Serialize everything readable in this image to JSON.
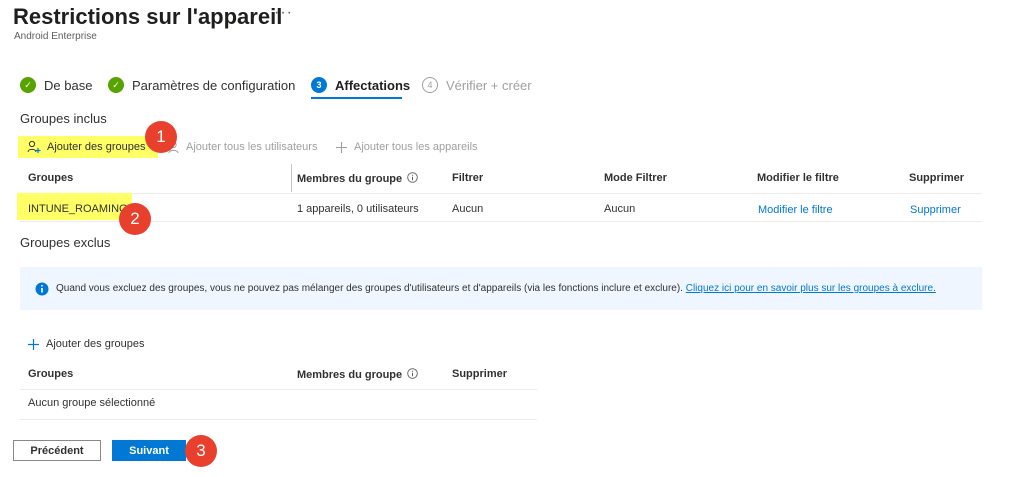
{
  "header": {
    "title": "Restrictions sur l'appareil",
    "more": "···",
    "subtitle": "Android Enterprise"
  },
  "steps": [
    {
      "label": "De base",
      "state": "done",
      "marker": "✓"
    },
    {
      "label": "Paramètres de configuration",
      "state": "done",
      "marker": "✓"
    },
    {
      "label": "Affectations",
      "state": "current",
      "marker": "3"
    },
    {
      "label": "Vérifier + créer",
      "state": "disabled",
      "marker": "4"
    }
  ],
  "included": {
    "title": "Groupes inclus",
    "add_groups": "Ajouter des groupes",
    "add_all_users": "Ajouter tous les utilisateurs",
    "add_all_devices": "Ajouter tous les appareils",
    "columns": [
      "Groupes",
      "Membres du groupe",
      "Filtrer",
      "Mode Filtrer",
      "Modifier le filtre",
      "Supprimer"
    ],
    "info_icon": "info-icon",
    "row": {
      "group": "INTUNE_ROAMING",
      "members": "1 appareils, 0 utilisateurs",
      "filter": "Aucun",
      "filter_mode": "Aucun",
      "edit_filter": "Modifier le filtre",
      "delete": "Supprimer"
    }
  },
  "excluded": {
    "title": "Groupes exclus",
    "info_text": "Quand vous excluez des groupes, vous ne pouvez pas mélanger des groupes d'utilisateurs et d'appareils (via les fonctions inclure et exclure).",
    "info_link": "Cliquez ici pour en savoir plus sur les groupes à exclure.",
    "add_groups": "Ajouter des groupes",
    "columns": [
      "Groupes",
      "Membres du groupe",
      "Supprimer"
    ],
    "empty": "Aucun groupe sélectionné"
  },
  "footer": {
    "previous": "Précédent",
    "next": "Suivant"
  },
  "annotations": [
    "1",
    "2",
    "3"
  ],
  "colors": {
    "accent": "#0078d4",
    "success": "#57a300",
    "highlight": "#ffff66",
    "annotation": "#e8402c"
  }
}
